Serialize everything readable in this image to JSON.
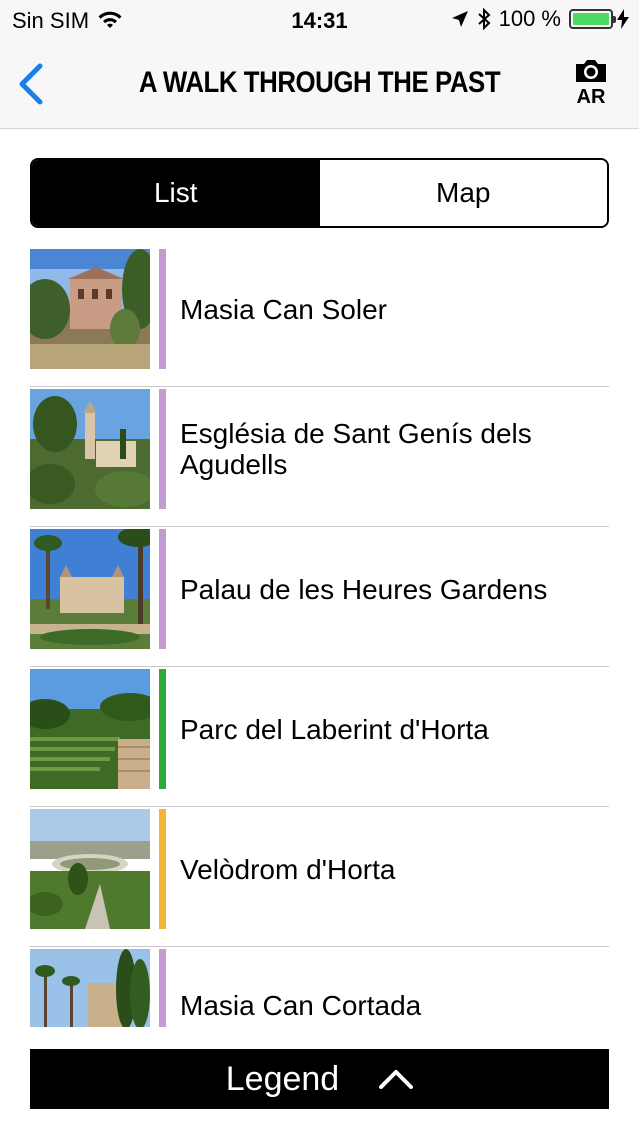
{
  "status_bar": {
    "carrier": "Sin SIM",
    "time": "14:31",
    "battery_percent": "100 %",
    "battery_level": 1.0,
    "icons": [
      "wifi-icon",
      "location-arrow-icon",
      "bluetooth-icon",
      "battery-icon",
      "charging-bolt-icon"
    ]
  },
  "nav": {
    "title": "A WALK THROUGH THE PAST",
    "back_icon": "chevron-left-icon",
    "ar_label": "AR",
    "ar_icon": "camera-icon",
    "accent_color": "#1a7fe8"
  },
  "tabs": [
    {
      "label": "List",
      "selected": true
    },
    {
      "label": "Map",
      "selected": false
    }
  ],
  "items": [
    {
      "title": "Masia Can Soler",
      "color": "#c39bd3"
    },
    {
      "title": "Església de Sant Genís dels Agudells",
      "color": "#c39bd3"
    },
    {
      "title": "Palau de les Heures Gardens",
      "color": "#c39bd3"
    },
    {
      "title": "Parc del Laberint d'Horta",
      "color": "#2eaa3c"
    },
    {
      "title": "Velòdrom d'Horta",
      "color": "#f3b63a"
    },
    {
      "title": "Masia Can Cortada",
      "color": "#c39bd3"
    }
  ],
  "legend": {
    "label": "Legend",
    "icon": "chevron-up-icon"
  }
}
